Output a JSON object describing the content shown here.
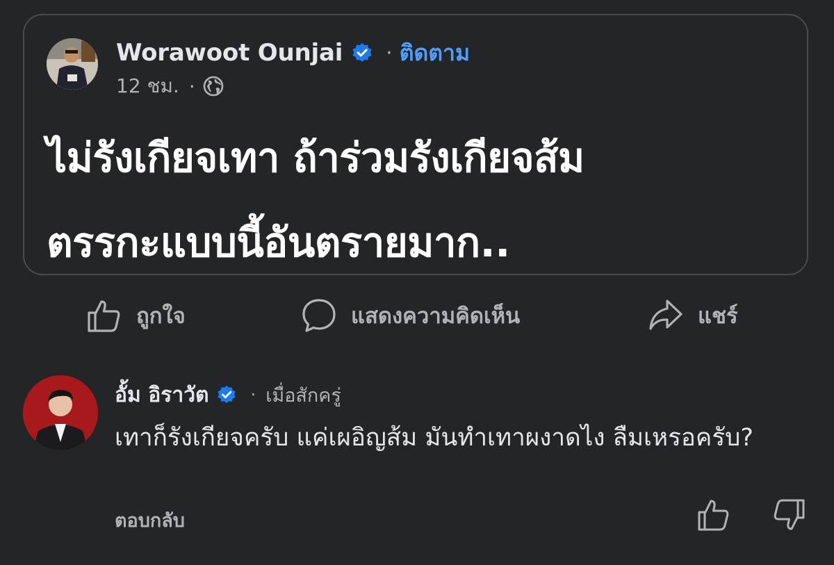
{
  "post": {
    "author_name": "Worawoot Ounjai",
    "separator": "·",
    "follow_label": "ติดตาม",
    "time_ago": "12 ชม.",
    "time_separator": "·",
    "privacy_icon": "globe-icon",
    "text_line1": "ไม่รังเกียจเทา ถ้าร่วมรังเกียจส้ม",
    "text_line2": "ตรรกะแบบนี้อันตรายมาก.."
  },
  "actions": {
    "like_label": "ถูกใจ",
    "comment_label": "แสดงความคิดเห็น",
    "share_label": "แชร์"
  },
  "comment": {
    "author_name": "อั้ม อิราวัต",
    "separator": "·",
    "time_ago": "เมื่อสักครู่",
    "text": "เทาก็รังเกียจครับ แค่เผอิญส้ม มันทำเทาผงาดไง ลืมเหรอครับ?",
    "reply_label": "ตอบกลับ"
  },
  "colors": {
    "background": "#242526",
    "accent_link": "#4e9dff",
    "verified_badge": "#1d7bf2",
    "muted_text": "#b0b3b8"
  }
}
